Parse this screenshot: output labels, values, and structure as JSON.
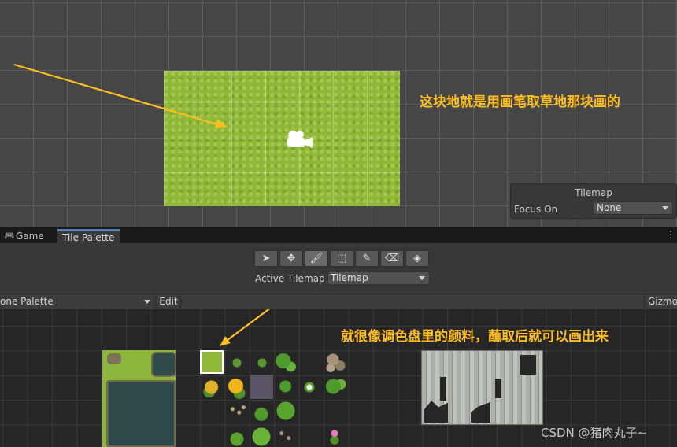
{
  "scene": {
    "annotation": "这块地就是用画笔取草地那块画的",
    "overlay": {
      "title": "Tilemap",
      "focus_label": "Focus On",
      "focus_value": "None"
    }
  },
  "tabs": [
    {
      "label": "Game",
      "icon": "gamepad-icon"
    },
    {
      "label": "Tile Palette"
    }
  ],
  "tools": [
    {
      "name": "select",
      "icon": "arrow-cursor-icon",
      "glyph": "➤"
    },
    {
      "name": "move",
      "icon": "move-icon",
      "glyph": "✥"
    },
    {
      "name": "paint",
      "icon": "brush-icon",
      "glyph": "🖌"
    },
    {
      "name": "box-fill",
      "icon": "box-fill-icon",
      "glyph": "⬚"
    },
    {
      "name": "picker",
      "icon": "eyedropper-icon",
      "glyph": "✎"
    },
    {
      "name": "erase",
      "icon": "eraser-icon",
      "glyph": "⌫"
    },
    {
      "name": "fill",
      "icon": "paint-bucket-icon",
      "glyph": "◈"
    }
  ],
  "active_tilemap": {
    "label": "Active Tilemap",
    "value": "Tilemap"
  },
  "palette_bar": {
    "palette_name": "one Palette",
    "edit_label": "Edit",
    "gizmos_label": "Gizmo"
  },
  "palette": {
    "annotation": "就很像调色盘里的颜料，蘸取后就可以画出来"
  },
  "watermark": "CSDN @猪肉丸子~",
  "colors": {
    "annotation": "#ffbf1e",
    "grass": "#8fb83a",
    "water": "#2f4a4a",
    "selected_tab_accent": "#4a86c8"
  }
}
